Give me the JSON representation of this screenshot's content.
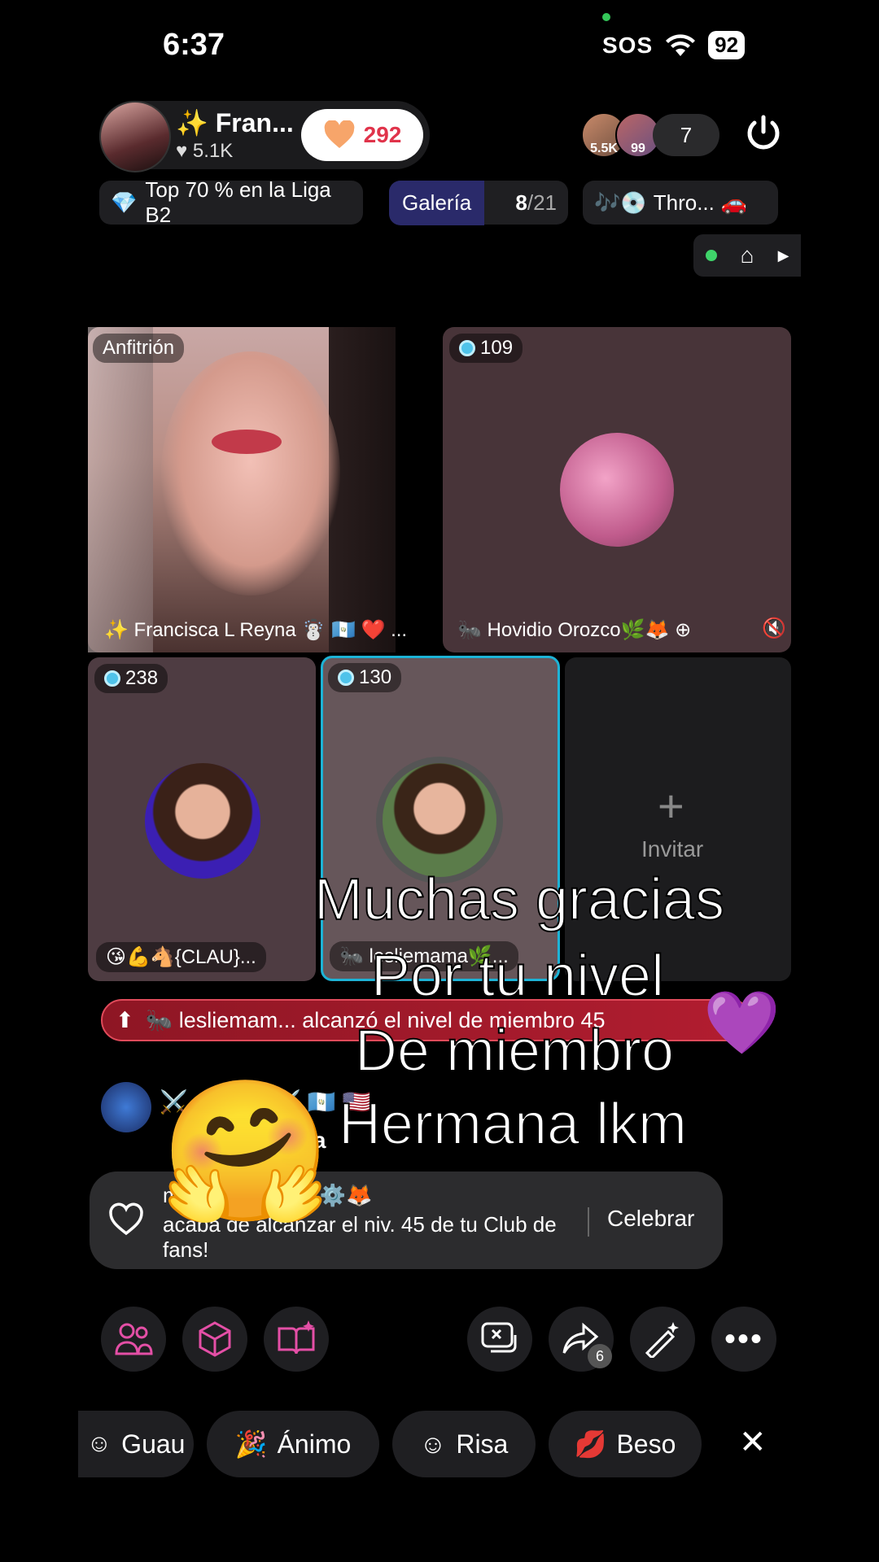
{
  "status_bar": {
    "time": "6:37",
    "sos": "SOS",
    "battery": "92"
  },
  "header": {
    "host_name": "✨ Fran...",
    "host_likes": "5.1K",
    "score": "292",
    "viewer_badge_1": "5.5K",
    "viewer_badge_2": "99",
    "viewer_count": "7"
  },
  "chips": {
    "league": "Top 70 % en la Liga B2",
    "gallery_label": "Galería",
    "gallery_count": "8",
    "gallery_total": "/21",
    "music": "Thro..."
  },
  "tiles": {
    "host_tag": "Anfitrión",
    "host_name": "✨ Francisca L Reyna ☃️ 🇬🇹 ❤️ ...",
    "tile_b_score": "109",
    "tile_b_name": "🐜 Hovidio Orozco🌿🦊",
    "tile_c_score": "238",
    "tile_c_name": "😘💪🐴{CLAU}...",
    "tile_d_score": "130",
    "tile_d_name": "🐜 lesliemama🌿...",
    "invite_label": "Invitar"
  },
  "banner": {
    "text": "🐜 lesliemam... alcanzó el nivel de miembro 45"
  },
  "chat": {
    "line1": "⚔️ Chapin ⚔️ 🇬🇹 🇺🇸",
    "line2": "dia"
  },
  "overlay": {
    "line1": "Muchas gracias",
    "line2": "Por tu nivel",
    "line3": "De miembro",
    "line4": "Hermana lkm",
    "emoji": "🤗"
  },
  "toast": {
    "user": "ma🌿😅🐨👮🦆⚙️🦊",
    "text": "acaba de alcanzar el niv. 45 de tu Club de fans!",
    "button": "Celebrar"
  },
  "toolbar": {
    "share_count": "6"
  },
  "reactions": [
    "Guau",
    "Ánimo",
    "Risa",
    "Beso"
  ],
  "colors": {
    "accent_red": "#e0334a",
    "highlight_blue": "#1db3d6",
    "banner_red": "#b21d30"
  }
}
